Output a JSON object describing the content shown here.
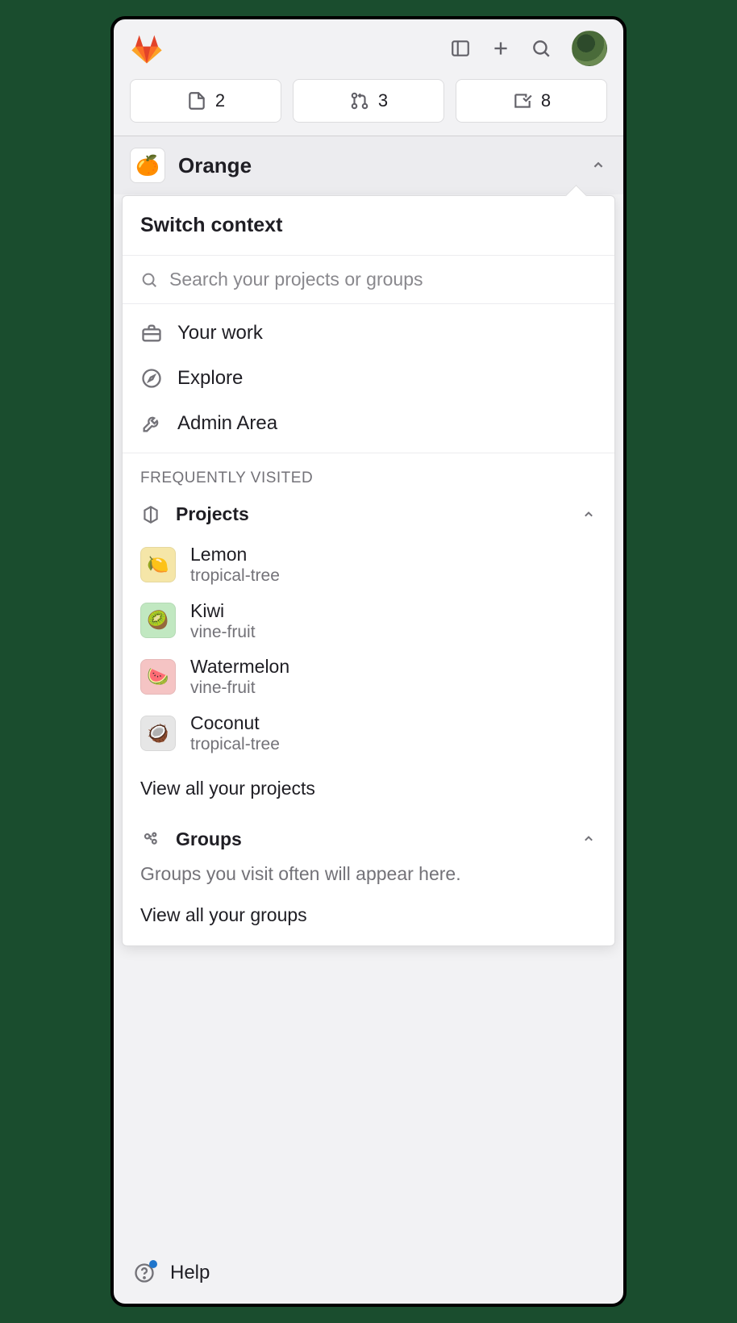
{
  "counts": {
    "issues": "2",
    "merge_requests": "3",
    "todos": "8"
  },
  "context": {
    "name": "Orange",
    "emoji": "🍊"
  },
  "popover": {
    "title": "Switch context",
    "search_placeholder": "Search your projects or groups",
    "nav": {
      "your_work": "Your work",
      "explore": "Explore",
      "admin": "Admin Area"
    },
    "freq_label": "FREQUENTLY VISITED",
    "projects_label": "Projects",
    "projects": [
      {
        "name": "Lemon",
        "sub": "tropical-tree",
        "emoji": "🍋",
        "bg": "#f5e6a8"
      },
      {
        "name": "Kiwi",
        "sub": "vine-fruit",
        "emoji": "🥝",
        "bg": "#c1e8c1"
      },
      {
        "name": "Watermelon",
        "sub": "vine-fruit",
        "emoji": "🍉",
        "bg": "#f5c4c4"
      },
      {
        "name": "Coconut",
        "sub": "tropical-tree",
        "emoji": "🥥",
        "bg": "#e6e6e6"
      }
    ],
    "view_all_projects": "View all your projects",
    "groups_label": "Groups",
    "groups_empty": "Groups you visit often will appear here.",
    "view_all_groups": "View all your groups"
  },
  "footer": {
    "help": "Help"
  }
}
